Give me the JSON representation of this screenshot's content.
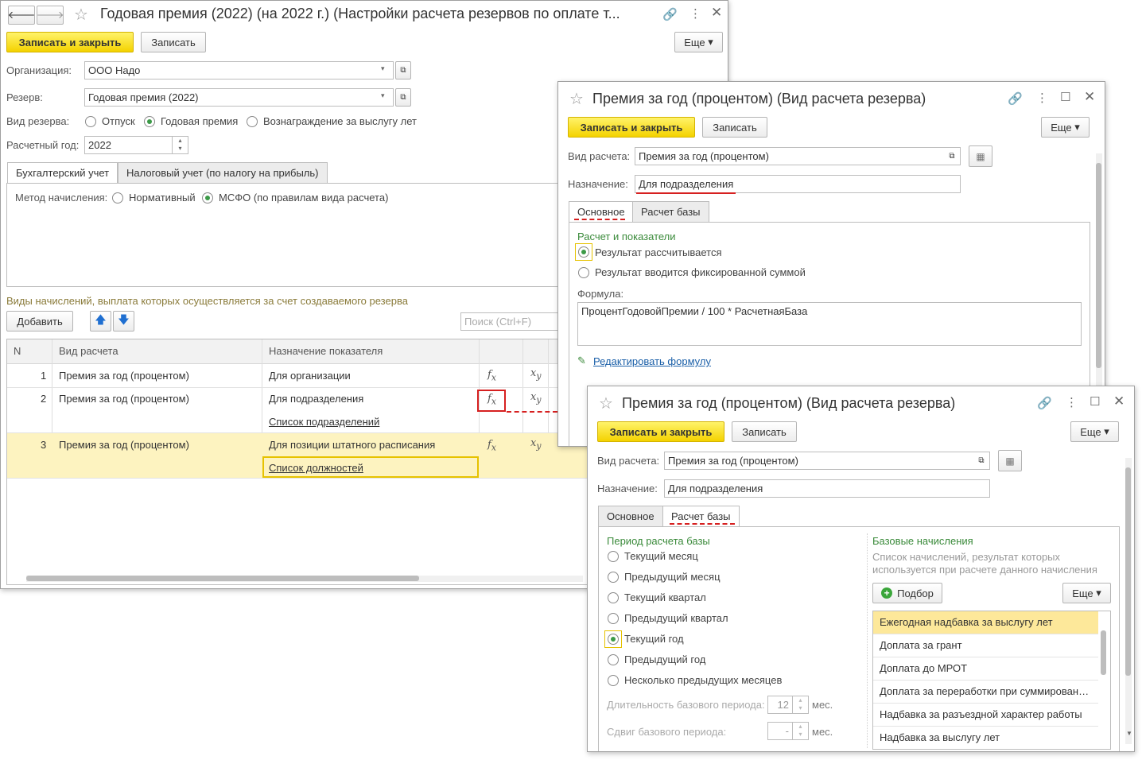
{
  "main": {
    "title": "Годовая премия (2022) (на 2022 г.) (Настройки расчета резервов по оплате т...",
    "save_close": "Записать и закрыть",
    "save": "Записать",
    "more": "Еще",
    "org_label": "Организация:",
    "org_value": "ООО Надо",
    "reserve_label": "Резерв:",
    "reserve_value": "Годовая премия (2022)",
    "kind_label": "Вид резерва:",
    "kind_options": [
      "Отпуск",
      "Годовая премия",
      "Вознаграждение за выслугу лет"
    ],
    "kind_selected": "Годовая премия",
    "year_label": "Расчетный год:",
    "year_value": "2022",
    "tabs": [
      "Бухгалтерский учет",
      "Налоговый учет (по налогу на прибыль)"
    ],
    "method_label": "Метод начисления:",
    "method_options": [
      "Нормативный",
      "МСФО (по правилам вида расчета)"
    ],
    "method_selected": "МСФО (по правилам вида расчета)",
    "section_title": "Виды начислений, выплата которых осуществляется за счет создаваемого резерва",
    "add_button": "Добавить",
    "search_placeholder": "Поиск (Ctrl+F)",
    "columns": [
      "N",
      "Вид расчета",
      "Назначение показателя"
    ],
    "fx_symbol": "fx",
    "xy_symbol": "xy",
    "rows": [
      {
        "n": "1",
        "kind": "Премия за год (процентом)",
        "purpose": "Для организации",
        "link": ""
      },
      {
        "n": "2",
        "kind": "Премия за год (процентом)",
        "purpose": "Для подразделения",
        "link": "Список подразделений"
      },
      {
        "n": "3",
        "kind": "Премия за год (процентом)",
        "purpose": "Для позиции штатного расписания",
        "link": "Список должностей"
      }
    ]
  },
  "dialog1": {
    "title": "Премия за год (процентом) (Вид расчета резерва)",
    "save_close": "Записать и закрыть",
    "save": "Записать",
    "more": "Еще",
    "calc_label": "Вид расчета:",
    "calc_value": "Премия за год (процентом)",
    "purpose_label": "Назначение:",
    "purpose_value": "Для подразделения",
    "tabs": [
      "Основное",
      "Расчет базы"
    ],
    "group_title": "Расчет и показатели",
    "result_options": [
      "Результат рассчитывается",
      "Результат вводится фиксированной суммой"
    ],
    "result_selected": "Результат рассчитывается",
    "formula_label": "Формула:",
    "formula_value": "ПроцентГодовойПремии / 100 * РасчетнаяБаза",
    "edit_formula": "Редактировать формулу"
  },
  "dialog2": {
    "title": "Премия за год (процентом) (Вид расчета резерва)",
    "save_close": "Записать и закрыть",
    "save": "Записать",
    "more": "Еще",
    "calc_label": "Вид расчета:",
    "calc_value": "Премия за год (процентом)",
    "purpose_label": "Назначение:",
    "purpose_value": "Для подразделения",
    "tabs": [
      "Основное",
      "Расчет базы"
    ],
    "period_title": "Период расчета базы",
    "periods": [
      "Текущий месяц",
      "Предыдущий месяц",
      "Текущий квартал",
      "Предыдущий квартал",
      "Текущий год",
      "Предыдущий год",
      "Несколько предыдущих месяцев"
    ],
    "period_selected": "Текущий год",
    "duration_label": "Длительность базового периода:",
    "duration_value": "12",
    "shift_label": "Сдвиг базового периода:",
    "shift_value": "-",
    "months_unit": "мес.",
    "base_title": "Базовые начисления",
    "base_desc_1": "Список начислений, результат которых",
    "base_desc_2": "используется при расчете данного начисления",
    "pick_button": "Подбор",
    "base_items": [
      "Ежегодная надбавка за выслугу лет",
      "Доплата за грант",
      "Доплата до МРОТ",
      "Доплата за переработки при суммированн...",
      "Надбавка за разъездной характер работы",
      "Надбавка за выслугу лет"
    ]
  },
  "colors": {
    "accent_yellow": "#f4d200",
    "group_green": "#3a8a3a",
    "link_blue": "#1a5fa8",
    "highlight_red": "#d62020",
    "selected_row": "#fdf3c0"
  }
}
